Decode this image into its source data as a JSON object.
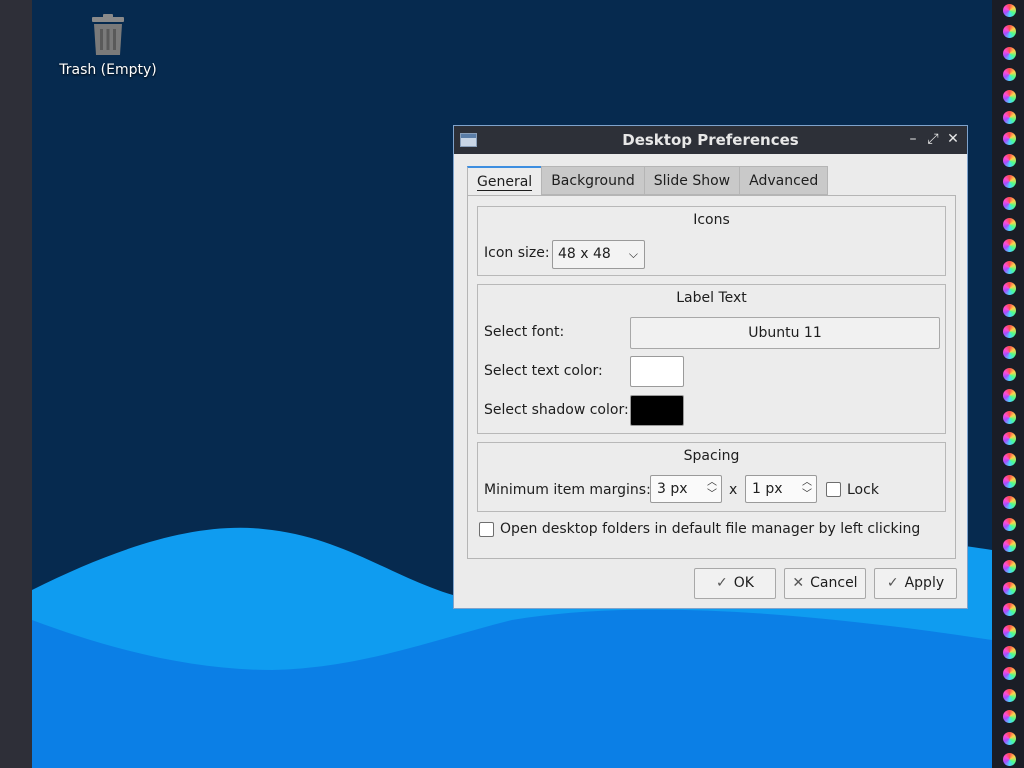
{
  "desktop": {
    "trash_label": "Trash (Empty)",
    "trash_icon": "trash-icon",
    "colors": {
      "sky": "#062a4f",
      "wave_light": "#0f9cf0",
      "wave_mid": "#0b7fe6"
    }
  },
  "dialog": {
    "title": "Desktop Preferences",
    "controls": {
      "minimize": "–",
      "maximize": "⤢",
      "close": "✕"
    },
    "tabs": [
      {
        "label": "General",
        "active": true
      },
      {
        "label": "Background",
        "active": false
      },
      {
        "label": "Slide Show",
        "active": false
      },
      {
        "label": "Advanced",
        "active": false
      }
    ],
    "icons_group": {
      "title": "Icons",
      "icon_size_label": "Icon size:",
      "icon_size_value": "48 x 48"
    },
    "label_text_group": {
      "title": "Label Text",
      "font_label": "Select font:",
      "font_value": "Ubuntu 11",
      "text_color_label": "Select text color:",
      "text_color": "#ffffff",
      "shadow_color_label": "Select shadow color:",
      "shadow_color": "#000000"
    },
    "spacing_group": {
      "title": "Spacing",
      "margins_label": "Minimum item margins:",
      "margin_x": "3 px",
      "separator": "x",
      "margin_y": "1 px",
      "lock_label": "Lock",
      "lock_checked": false
    },
    "open_folders_label": "Open desktop folders in default file manager by left clicking",
    "open_folders_checked": false,
    "buttons": {
      "ok": "OK",
      "cancel": "Cancel",
      "apply": "Apply"
    }
  }
}
